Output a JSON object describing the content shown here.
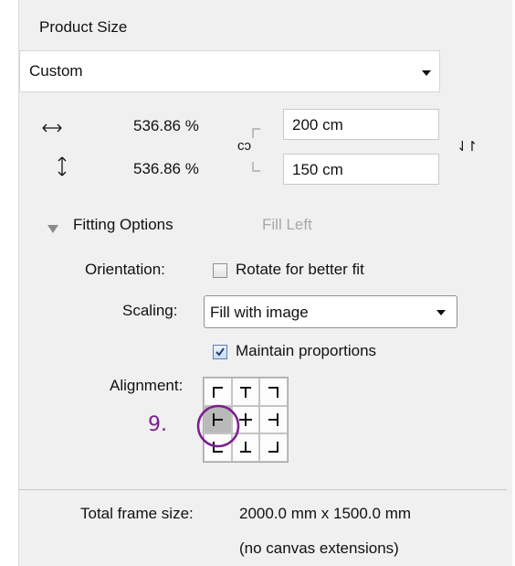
{
  "product_size": {
    "title": "Product Size",
    "preset_value": "Custom",
    "width_percent": "536.86 %",
    "height_percent": "536.86 %",
    "width_value": "200 cm",
    "height_value": "150 cm",
    "link_glyph": "сɔ",
    "swap_glyph": "⇃↾"
  },
  "fitting": {
    "title": "Fitting Options",
    "mode": "Fill Left",
    "orientation_label": "Orientation:",
    "rotate_label": "Rotate for better fit",
    "rotate_checked": false,
    "scaling_label": "Scaling:",
    "scaling_value": "Fill with image",
    "maintain_label": "Maintain proportions",
    "maintain_checked": true,
    "alignment_label": "Alignment:",
    "alignment_selected": "middle-left",
    "annotation": "9."
  },
  "footer": {
    "total_label": "Total frame size:",
    "total_value": "2000.0 mm x 1500.0 mm",
    "note": "(no canvas extensions)"
  },
  "colors": {
    "panel_bg": "#f0f0f0",
    "annotation": "#7b1e8f",
    "checkbox_border": "#5a7fb5"
  }
}
